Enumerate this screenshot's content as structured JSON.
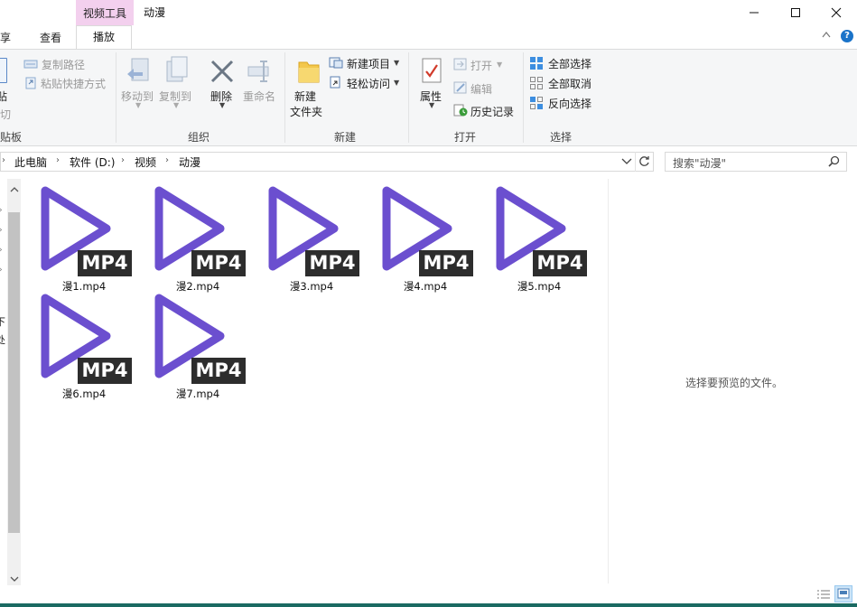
{
  "titlebar": {
    "context_group": "视频工具",
    "title": "动漫"
  },
  "tabs": {
    "share": "共享",
    "view": "查看",
    "play": "播放"
  },
  "ribbon": {
    "clipboard": {
      "copy_path": "复制路径",
      "paste_shortcut": "粘贴快捷方式",
      "paste_partial": "贴",
      "cut_partial": "剪切",
      "label": "剪贴板"
    },
    "organize": {
      "move_to": "移动到",
      "copy_to": "复制到",
      "delete": "删除",
      "rename": "重命名",
      "label": "组织"
    },
    "new": {
      "new_folder_line1": "新建",
      "new_folder_line2": "文件夹",
      "new_item": "新建项目",
      "easy_access": "轻松访问",
      "label": "新建"
    },
    "open": {
      "properties": "属性",
      "open": "打开",
      "edit": "编辑",
      "history": "历史记录",
      "label": "打开"
    },
    "select": {
      "select_all": "全部选择",
      "select_none": "全部取消",
      "invert": "反向选择",
      "label": "选择"
    }
  },
  "address": {
    "crumbs": [
      "此电脑",
      "软件 (D:)",
      "视频",
      "动漫"
    ],
    "search_placeholder": "搜索\"动漫\""
  },
  "files": [
    {
      "name": "漫1.mp4",
      "tag": "MP4"
    },
    {
      "name": "漫2.mp4",
      "tag": "MP4"
    },
    {
      "name": "漫3.mp4",
      "tag": "MP4"
    },
    {
      "name": "漫4.mp4",
      "tag": "MP4"
    },
    {
      "name": "漫5.mp4",
      "tag": "MP4"
    },
    {
      "name": "漫6.mp4",
      "tag": "MP4"
    },
    {
      "name": "漫7.mp4",
      "tag": "MP4"
    }
  ],
  "preview": {
    "message": "选择要预览的文件。"
  },
  "nav_partial": {
    "a": "下",
    "b": "处"
  },
  "colors": {
    "play_icon": "#6b4fcf",
    "context_tab": "#f3d0ee",
    "accent_bottom": "#1a6a62"
  }
}
